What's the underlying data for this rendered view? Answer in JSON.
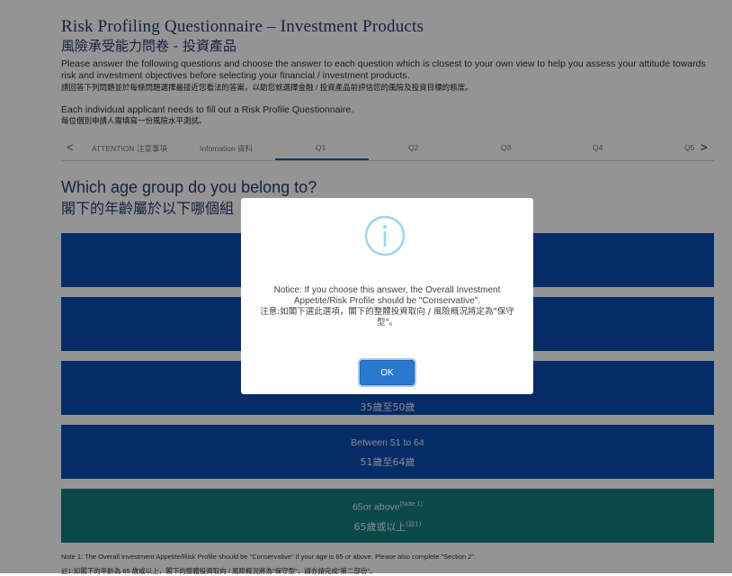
{
  "header": {
    "title_en": "Risk Profiling Questionnaire – Investment Products",
    "title_zh": "風險承受能力問卷 - 投資產品",
    "intro_en": "Please answer the following questions and choose the answer to each question which is closest to your own view to help you assess your attitude towards risk and investment objectives before selecting your financial / investment products.",
    "intro_zh": "請回答下列問題並於每條問題選擇最接近您看法的答案，以助您就選擇金融 / 投資產品前評估您的風險及投資目標的態度。",
    "applicant_en": "Each individual applicant needs to fill out a Risk Profile Questionnaire.",
    "applicant_zh": "每位個別申請人需填寫一份風險水平測試。"
  },
  "tabs": {
    "prev": "<",
    "next": ">",
    "items": [
      "ATTENTION 注意事項",
      "Infomation 資料",
      "Q1",
      "Q2",
      "Q3",
      "Q4",
      "Q5"
    ],
    "active": "Q1"
  },
  "question": {
    "en": "Which age group do you belong to?",
    "zh": "閣下的年齡屬於以下哪個組"
  },
  "options": [
    {
      "en": "",
      "zh": ""
    },
    {
      "en": "",
      "zh": ""
    },
    {
      "en": "",
      "zh": "35歲至50歲"
    },
    {
      "en": "Between 51 to 64",
      "zh": "51歲至64歲"
    },
    {
      "en": "65or above",
      "zh": "65歲或以上",
      "note_en": "(Note 1)",
      "note_zh": "(註1)"
    }
  ],
  "notes": {
    "note1_en": "Note 1: The Overall Investment Appetite/Risk Profile should be \"Conservative\" if your age is 65 or above. Please also complete \"Section 2\".",
    "note1_zh": "註1:如閣下的年齡為 65 歲或以上，閣下的整體投資取向 / 風險概況將為\"保守型\"，請亦請完成\"第二部份\"。"
  },
  "modal": {
    "icon": "info-icon",
    "notice_en": "Notice: If you choose this answer, the Overall Investment Appetite/Risk Profile should be \"Conservative\".",
    "notice_zh": "注意:如閣下選此選項，閣下的整體投資取向 / 風險概況將定為\"保守型\"。",
    "ok_label": "OK"
  },
  "colors": {
    "option_blue": "#0a4db2",
    "option_selected": "#127f7a",
    "title": "#2a3a6e",
    "ok_button": "#2b79cf"
  }
}
